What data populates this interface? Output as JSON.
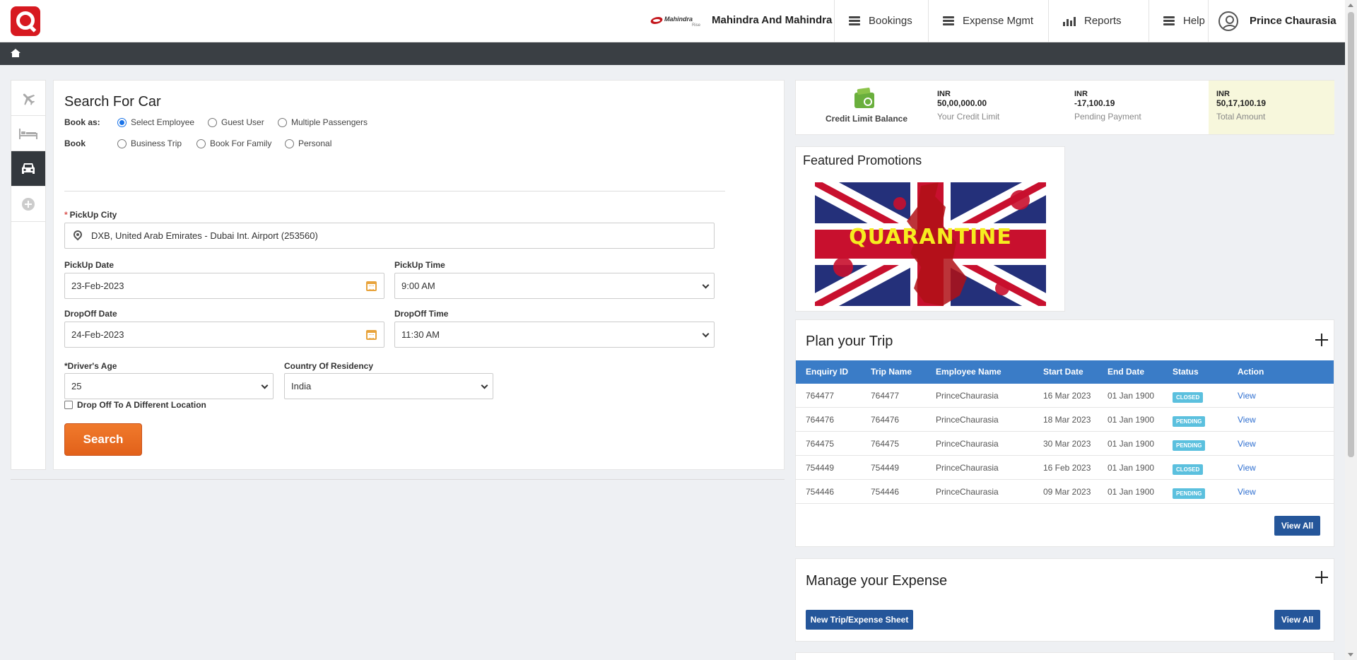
{
  "header": {
    "brand_logo_text": "Mahindra",
    "brand_logo_sub": "Rise",
    "company": "Mahindra And Mahindra",
    "nav": [
      "Bookings",
      "Expense Mgmt",
      "Reports",
      "Help"
    ],
    "user": "Prince Chaurasia"
  },
  "search": {
    "title": "Search For Car",
    "book_as_label": "Book as:",
    "book_as_options": [
      "Select Employee",
      "Guest User",
      "Multiple Passengers"
    ],
    "book_as_selected": "Select Employee",
    "book_label": "Book",
    "book_options": [
      "Business Trip",
      "Book For Family",
      "Personal"
    ],
    "pickup_city_label": "PickUp City",
    "pickup_city_value": "DXB, United Arab Emirates - Dubai Int. Airport (253560)",
    "pickup_date_label": "PickUp Date",
    "pickup_date_value": "23-Feb-2023",
    "pickup_time_label": "PickUp Time",
    "pickup_time_value": "9:00 AM",
    "dropoff_date_label": "DropOff Date",
    "dropoff_date_value": "24-Feb-2023",
    "dropoff_time_label": "DropOff Time",
    "dropoff_time_value": "11:30 AM",
    "driver_age_label": "*Driver's Age",
    "driver_age_value": "25",
    "country_label": "Country Of Residency",
    "country_value": "India",
    "different_location_label": "Drop Off To A Different Location",
    "search_button": "Search"
  },
  "credit": {
    "title": "Credit Limit Balance",
    "items": [
      {
        "currency": "INR",
        "amount": "50,00,000.00",
        "caption": "Your Credit Limit"
      },
      {
        "currency": "INR",
        "amount": "-17,100.19",
        "caption": "Pending Payment"
      },
      {
        "currency": "INR",
        "amount": "50,17,100.19",
        "caption": "Total Amount"
      }
    ]
  },
  "promotions": {
    "title": "Featured Promotions",
    "banner_text": "QUARANTINE"
  },
  "plan": {
    "title": "Plan your Trip",
    "columns": [
      "Enquiry ID",
      "Trip Name",
      "Employee Name",
      "Start Date",
      "End Date",
      "Status",
      "Action"
    ],
    "rows": [
      {
        "id": "764477",
        "trip": "764477",
        "employee": "PrinceChaurasia",
        "start": "16 Mar 2023",
        "end": "01 Jan 1900",
        "status": "CLOSED",
        "action": "View"
      },
      {
        "id": "764476",
        "trip": "764476",
        "employee": "PrinceChaurasia",
        "start": "18 Mar 2023",
        "end": "01 Jan 1900",
        "status": "PENDING",
        "action": "View"
      },
      {
        "id": "764475",
        "trip": "764475",
        "employee": "PrinceChaurasia",
        "start": "30 Mar 2023",
        "end": "01 Jan 1900",
        "status": "PENDING",
        "action": "View"
      },
      {
        "id": "754449",
        "trip": "754449",
        "employee": "PrinceChaurasia",
        "start": "16 Feb 2023",
        "end": "01 Jan 1900",
        "status": "CLOSED",
        "action": "View"
      },
      {
        "id": "754446",
        "trip": "754446",
        "employee": "PrinceChaurasia",
        "start": "09 Mar 2023",
        "end": "01 Jan 1900",
        "status": "PENDING",
        "action": "View"
      }
    ],
    "view_all": "View All"
  },
  "expense": {
    "title": "Manage your Expense",
    "new_button": "New Trip/Expense Sheet",
    "view_all": "View All"
  }
}
